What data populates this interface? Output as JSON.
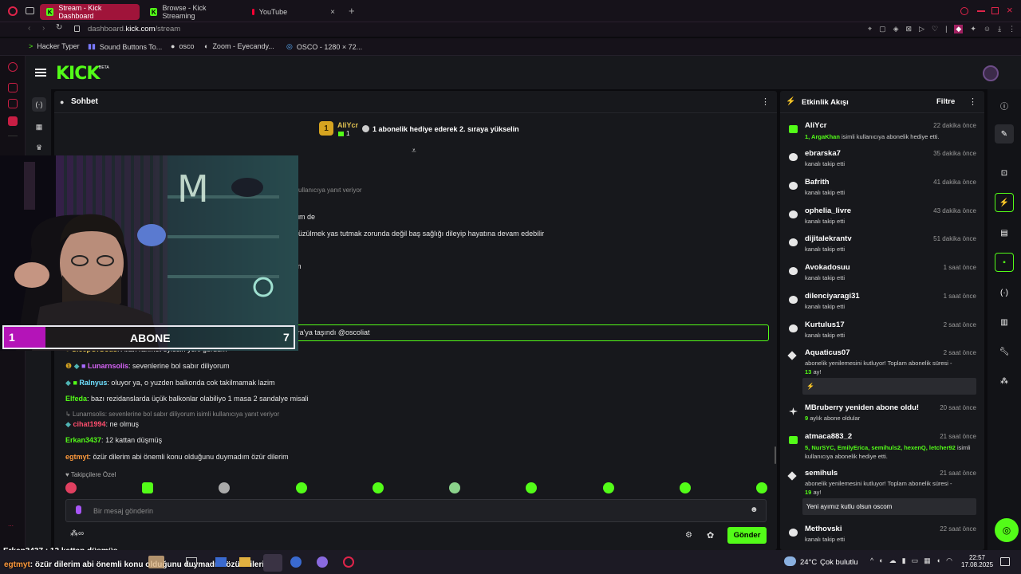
{
  "tabs": [
    {
      "label": "Stream - Kick Dashboard",
      "active": true
    },
    {
      "label": "Browse - Kick Streaming",
      "active": false
    },
    {
      "label": "YouTube",
      "active": false
    }
  ],
  "address": {
    "prefix": "dashboard.",
    "domain": "kick.com",
    "path": "/stream"
  },
  "bookmarks": [
    "Hacker Typer",
    "Sound Buttons To...",
    "osco",
    "Zoom - Eyecandy...",
    "OSCO - 1280 × 72..."
  ],
  "brand": {
    "logo": "KICK",
    "beta": "BETA",
    "accent": "#53fc18"
  },
  "chat": {
    "title": "Sohbet",
    "gift_banner": {
      "user": "AliYcr",
      "count": "1",
      "rank": "1",
      "text": "1 abonelik hediye ederek 2. sıraya yükselin"
    },
    "partial_lines": [
      "kullanıcıya yanıt veriyor",
      "üm de",
      "üzülmek yas tutmak zorunda değil baş sağlığı dileyip hayatına devam edebilir",
      "m"
    ],
    "messages": [
      {
        "user": "emirhacili",
        "color": "#a86bff",
        "text": "eskiden ......aydı Çağrıyla aynı rezidansta idiler sonra Ankara'ya taşındı @oscoliat"
      },
      {
        "user": "SleepOfGods",
        "color": "#e0c050",
        "text": "Allah rahmet eylesin yeni gördüm"
      },
      {
        "user": "Lunarnsolis",
        "color": "#d563f5",
        "text": "sevenlerine bol sabır diliyorum"
      },
      {
        "user": "Ralnyus",
        "color": "#6ee0ff",
        "text": "oluyor ya, o yuzden balkonda cok takilmamak lazim"
      },
      {
        "user": "Elfeda",
        "color": "#53fc18",
        "text": "bazı rezidanslarda üçük balkonlar olabiliyo 1 masa 2 sandalye misali"
      },
      {
        "reply": "Lunarnsolis: sevenlerine bol sabır diliyorum isimli kullanıcıya yanıt veriyor",
        "user": "cihat1994",
        "color": "#ff4d6d",
        "text": "ne olmuş"
      },
      {
        "user": "Erkan3437",
        "color": "#53fc18",
        "text": "12 kattan düşmüş"
      },
      {
        "user": "egtmyt",
        "color": "#ff9a3c",
        "text": "özür dilerim abi önemli konu olduğunu duymadım özür dilerim"
      }
    ],
    "emote_label": "Takipçilere Özel",
    "input_placeholder": "Bir mesaj gönderin",
    "send_label": "Gönder"
  },
  "overlay": {
    "label": "ABONE",
    "left": "1",
    "right": "7"
  },
  "ticker": {
    "line1": "Erkan3437 : 12 kattan düşmüş",
    "line2_user": "egtmyt",
    "line2": "özür dilerim abi önemli konu olduğunu duymadım özür dilerim"
  },
  "feed": {
    "title": "Etkinlik Akışı",
    "filter": "Filtre",
    "items": [
      {
        "type": "gift",
        "name": "AliYcr",
        "time": "22 dakika önce",
        "sub_hl": "1, ArgaKhan",
        "sub": "isimli kullanıcıya abonelik hediye etti."
      },
      {
        "type": "follow",
        "name": "ebrarska7",
        "time": "35 dakika önce",
        "sub": "kanalı takip etti"
      },
      {
        "type": "follow",
        "name": "Bafrith",
        "time": "41 dakika önce",
        "sub": "kanalı takip etti"
      },
      {
        "type": "follow",
        "name": "ophelia_livre",
        "time": "43 dakika önce",
        "sub": "kanalı takip etti"
      },
      {
        "type": "follow",
        "name": "dijitalekrantv",
        "time": "51 dakika önce",
        "sub": "kanalı takip etti"
      },
      {
        "type": "follow",
        "name": "Avokadosuu",
        "time": "1 saat önce",
        "sub": "kanalı takip etti"
      },
      {
        "type": "follow",
        "name": "dilenciyaragi31",
        "time": "1 saat önce",
        "sub": "kanalı takip etti"
      },
      {
        "type": "follow",
        "name": "Kurtulus17",
        "time": "2 saat önce",
        "sub": "kanalı takip etti"
      },
      {
        "type": "resub",
        "name": "Aquaticus07",
        "time": "2 saat önce",
        "sub": "abonelik yenilemesini kutluyor! Toplam abonelik süresi -",
        "months": "13",
        "months_suffix": "ay!",
        "box": "⚡"
      },
      {
        "type": "sub",
        "name": "MBruberry yeniden abone oldu!",
        "time": "20 saat önce",
        "sub_hl": "9",
        "sub": "aylık abone oldular"
      },
      {
        "type": "gift",
        "name": "atmaca883_2",
        "time": "21 saat önce",
        "sub_hl": "5, NurSYC, EmilyErica, semihuls2, hexenQ, letcher92",
        "sub": "isimli kullanıcıya abonelik hediye etti."
      },
      {
        "type": "resub",
        "name": "semihuls",
        "time": "21 saat önce",
        "sub": "abonelik yenilemesini kutluyor! Toplam abonelik süresi -",
        "months": "19",
        "months_suffix": "ay!",
        "box": "Yeni ayımız kutlu olsun oscom"
      },
      {
        "type": "follow",
        "name": "Methovski",
        "time": "22 saat önce",
        "sub": "kanalı takip etti"
      }
    ]
  },
  "taskbar": {
    "weather": "24°C",
    "weather_desc": "Çok bulutlu",
    "time": "22:57",
    "date": "17.08.2025"
  }
}
